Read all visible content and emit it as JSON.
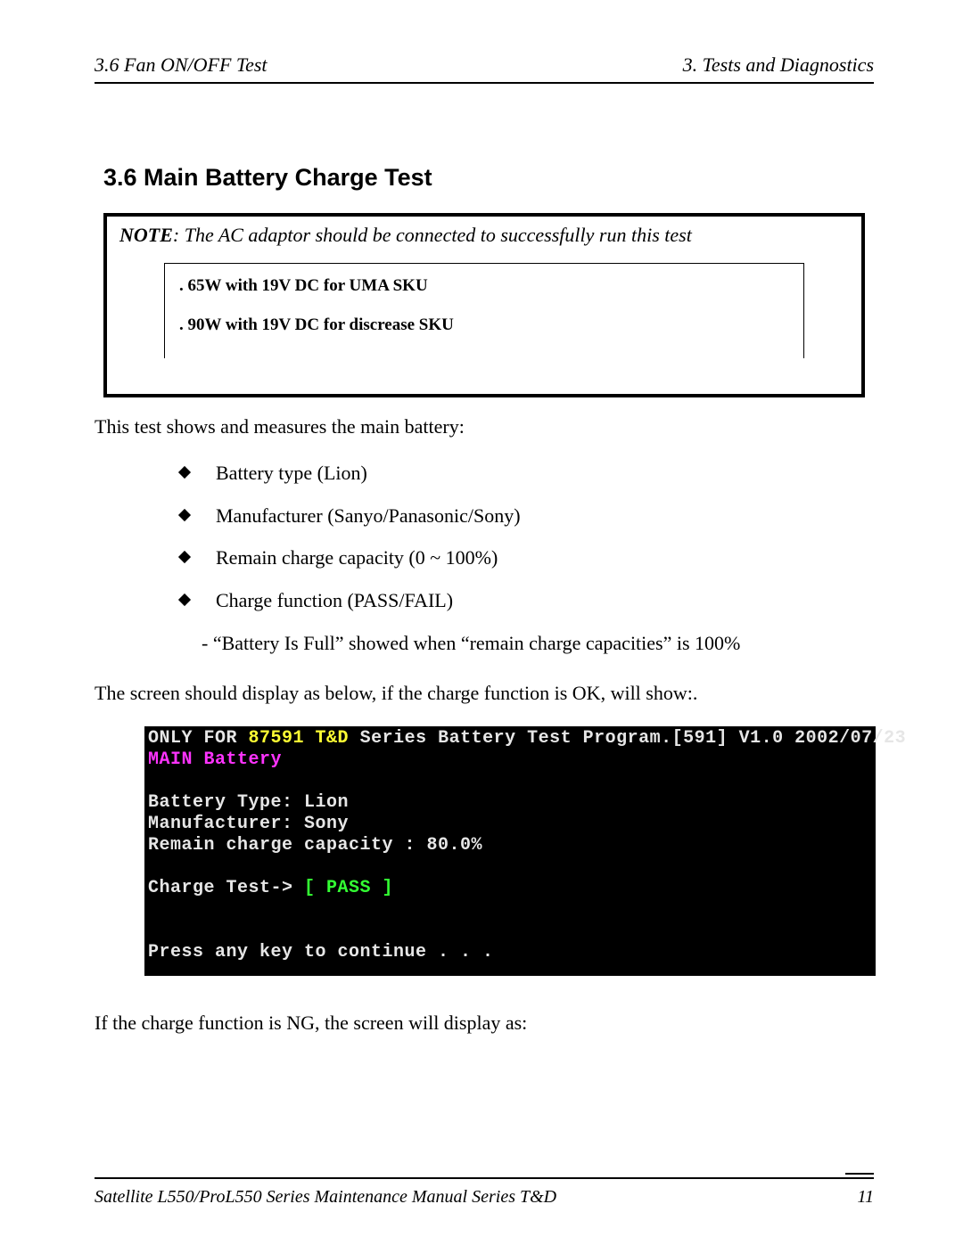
{
  "header": {
    "left": "3.6 Fan ON/OFF Test",
    "right": "3.  Tests and Diagnostics"
  },
  "section": {
    "title": "3.6 Main Battery Charge Test"
  },
  "note": {
    "label": "NOTE",
    "text": ":  The AC adaptor  should be connected to successfully run this test",
    "sku1": ".  65W with 19V DC for UMA SKU",
    "sku2": ". 90W with 19V DC for discrease  SKU"
  },
  "para_intro": "This test shows and measures the main battery:",
  "bullets": {
    "b1": "Battery type (Lion)",
    "b2": "Manufacturer (Sanyo/Panasonic/Sony)",
    "b3": "Remain charge capacity (0 ~ 100%)",
    "b4": "Charge function (PASS/FAIL)"
  },
  "sub_b4": "- “Battery Is Full” showed when “remain charge capacities” is 100%",
  "para_screen": "The screen should display as below, if the charge function is OK, will show:.",
  "terminal": {
    "l1a": "ONLY FOR ",
    "l1b": "87591 T&D",
    "l1c": " Series Battery Test Program.[591] V1.0 2002/07/23",
    "l2": "MAIN Battery",
    "l4": "Battery Type: Lion",
    "l5": "Manufacturer: Sony",
    "l6": "Remain charge capacity : 80.0%",
    "l8a": "Charge Test-> ",
    "l8b": "[ PASS ]",
    "l10": "Press any key to continue . . ."
  },
  "para_ng": " If the charge function is NG, the screen will display as:",
  "footer": {
    "left": "Satellite L550/ProL550 Series Maintenance Manual Series T&D",
    "page": "11"
  }
}
